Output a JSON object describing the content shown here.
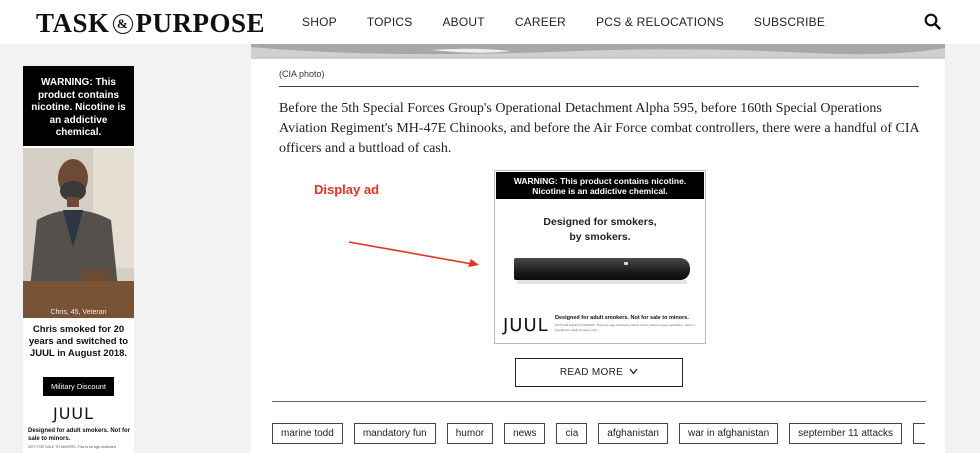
{
  "header": {
    "logo_left": "TASK",
    "logo_amp": "&",
    "logo_right": "PURPOSE",
    "nav": [
      "SHOP",
      "TOPICS",
      "ABOUT",
      "CAREER",
      "PCS & RELOCATIONS",
      "SUBSCRIBE"
    ],
    "search_icon": "search-icon"
  },
  "sidebar_ad": {
    "warning": "WARNING: This product contains nicotine. Nicotine is an addictive chemical.",
    "photo_caption": "Chris, 45, Veteran",
    "story": "Chris smoked for 20 years and switched to JUUL in August 2018.",
    "button": "Military Discount",
    "brand": "JUUL",
    "disclaimer": "Designed for adult smokers. Not for sale to minors.",
    "fineprint": "NOT FOR SALE TO MINORS. This is an age-restricted"
  },
  "article": {
    "photo_credit": "(CIA photo)",
    "paragraph": "Before the 5th Special Forces Group's Operational Detachment Alpha 595, before 160th Special Operations Aviation Regiment's MH-47E Chinooks, and before the Air Force combat controllers, there were a handful of CIA officers and a buttload of cash.",
    "annotation": "Display ad",
    "annotation_color": "#e8321c",
    "read_more": "READ MORE"
  },
  "center_ad": {
    "warning_line1": "WARNING: This product contains nicotine.",
    "warning_line2": "Nicotine is an addictive chemical.",
    "tagline_line1": "Designed for smokers,",
    "tagline_line2": "by smokers.",
    "brand": "JUUL",
    "disclaimer": "Designed for adult smokers. Not for sale to minors.",
    "fineprint": "NOT FOR SALE TO MINORS. This is an age-restricted product and is subject to age verification. JUUL is intended for adult smokers only."
  },
  "tags": [
    "marine todd",
    "mandatory fun",
    "humor",
    "news",
    "cia",
    "afghanistan",
    "war in afghanistan",
    "september 11 attacks"
  ]
}
